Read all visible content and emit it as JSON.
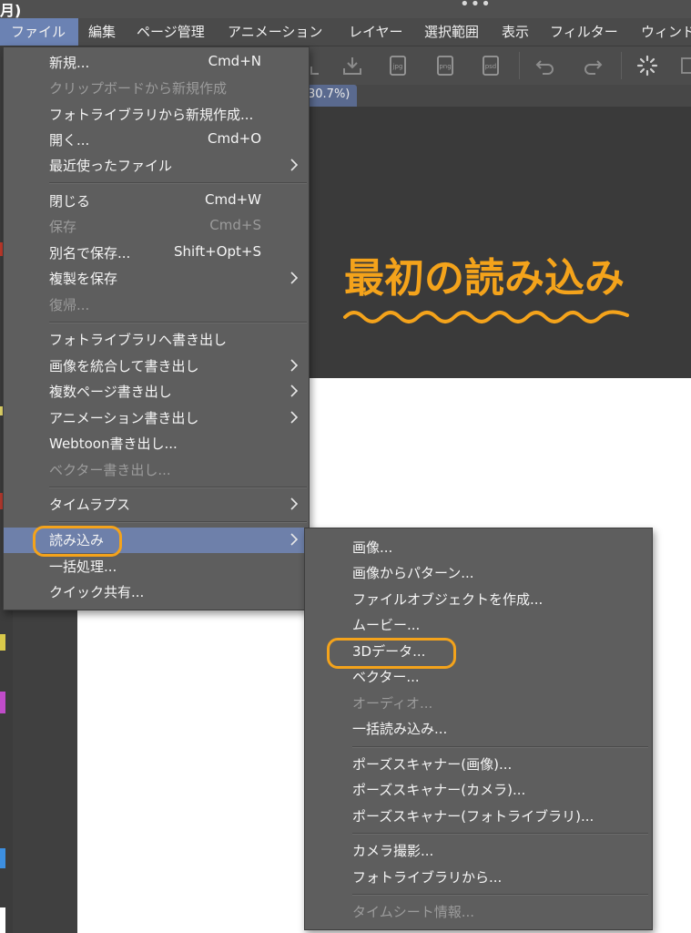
{
  "app": {
    "title_fragment": "月)",
    "more_dots": "•••"
  },
  "menubar": {
    "items": [
      {
        "label": "ファイル",
        "active": true
      },
      {
        "label": "編集"
      },
      {
        "label": "ページ管理"
      },
      {
        "label": "アニメーション"
      },
      {
        "label": "レイヤー"
      },
      {
        "label": "選択範囲"
      },
      {
        "label": "表示"
      },
      {
        "label": "フィルター"
      },
      {
        "label": "ウィンド"
      }
    ]
  },
  "toolbar": {
    "icons": [
      "save-icon",
      "export-icon",
      "jpg-export-icon",
      "png-export-icon",
      "psd-export-icon",
      "undo-icon",
      "redo-icon",
      "loading-spinner-icon"
    ],
    "jpg_label": "jpg",
    "png_label": "png",
    "psd_label": "psd"
  },
  "document": {
    "zoom_tab_label": "30.7%)"
  },
  "canvas": {
    "handwriting_text": "最初の読み込み",
    "accent_color": "#f4a31b"
  },
  "file_menu": {
    "items": [
      {
        "label": "新規...",
        "shortcut": "Cmd+N"
      },
      {
        "label": "クリップボードから新規作成",
        "disabled": true
      },
      {
        "label": "フォトライブラリから新規作成..."
      },
      {
        "label": "開く...",
        "shortcut": "Cmd+O"
      },
      {
        "label": "最近使ったファイル",
        "submenu": true
      },
      {
        "label": "閉じる",
        "shortcut": "Cmd+W"
      },
      {
        "label": "保存",
        "shortcut": "Cmd+S",
        "disabled": true
      },
      {
        "label": "別名で保存...",
        "shortcut": "Shift+Opt+S"
      },
      {
        "label": "複製を保存",
        "submenu": true
      },
      {
        "label": "復帰...",
        "disabled": true
      },
      {
        "label": "フォトライブラリへ書き出し"
      },
      {
        "label": "画像を統合して書き出し",
        "submenu": true
      },
      {
        "label": "複数ページ書き出し",
        "submenu": true
      },
      {
        "label": "アニメーション書き出し",
        "submenu": true
      },
      {
        "label": "Webtoon書き出し..."
      },
      {
        "label": "ベクター書き出し...",
        "disabled": true
      },
      {
        "label": "タイムラプス",
        "submenu": true
      },
      {
        "label": "読み込み",
        "submenu": true,
        "highlighted": true
      },
      {
        "label": "一括処理..."
      },
      {
        "label": "クイック共有..."
      }
    ]
  },
  "import_submenu": {
    "items": [
      {
        "label": "画像..."
      },
      {
        "label": "画像からパターン..."
      },
      {
        "label": "ファイルオブジェクトを作成..."
      },
      {
        "label": "ムービー..."
      },
      {
        "label": "3Dデータ..."
      },
      {
        "label": "ベクター..."
      },
      {
        "label": "オーディオ...",
        "disabled": true
      },
      {
        "label": "一括読み込み..."
      },
      {
        "label": "ポーズスキャナー(画像)..."
      },
      {
        "label": "ポーズスキャナー(カメラ)..."
      },
      {
        "label": "ポーズスキャナー(フォトライブラリ)..."
      },
      {
        "label": "カメラ撮影..."
      },
      {
        "label": "フォトライブラリから..."
      },
      {
        "label": "タイムシート情報...",
        "disabled": true
      }
    ]
  }
}
